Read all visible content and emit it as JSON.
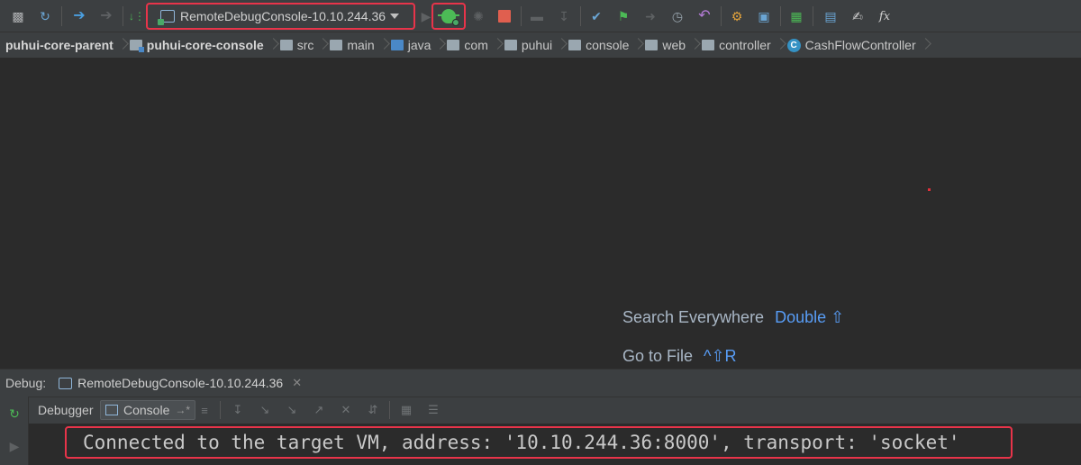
{
  "toolbar": {
    "run_config": "RemoteDebugConsole-10.10.244.36",
    "icons": [
      "save-icon",
      "sync-icon",
      "back-icon",
      "forward-icon",
      "build-icon",
      "run-config-icon",
      "run-icon",
      "debug-icon",
      "coverage-icon",
      "stop-icon",
      "git-icon",
      "vcs-update-icon",
      "vcs-commit-icon",
      "vcs-branch-icon",
      "vcs-push-icon",
      "vcs-history-icon",
      "revert-icon",
      "structure-icon",
      "sdk-icon",
      "project-icon",
      "terminal-icon",
      "puzzle-icon",
      "function-icon"
    ],
    "fx_label": "fx"
  },
  "breadcrumbs": [
    {
      "label": "puhui-core-parent",
      "type": "module"
    },
    {
      "label": "puhui-core-console",
      "type": "module"
    },
    {
      "label": "src",
      "type": "folder"
    },
    {
      "label": "main",
      "type": "folder"
    },
    {
      "label": "java",
      "type": "source-folder"
    },
    {
      "label": "com",
      "type": "folder"
    },
    {
      "label": "puhui",
      "type": "folder"
    },
    {
      "label": "console",
      "type": "folder"
    },
    {
      "label": "web",
      "type": "folder"
    },
    {
      "label": "controller",
      "type": "folder"
    },
    {
      "label": "CashFlowController",
      "type": "class"
    }
  ],
  "editor": {
    "hints": [
      {
        "label": "Search Everywhere",
        "key": "Double ⇧"
      },
      {
        "label": "Go to File",
        "key": "^⇧R"
      }
    ]
  },
  "debug": {
    "label": "Debug:",
    "tab": "RemoteDebugConsole-10.10.244.36",
    "subtabs": {
      "debugger": "Debugger",
      "console": "Console"
    },
    "console_output": "Connected to the target VM, address: '10.10.244.36:8000', transport: 'socket'"
  },
  "colors": {
    "highlight": "#e8344a",
    "link": "#589df6",
    "debug_green": "#4cba56"
  }
}
